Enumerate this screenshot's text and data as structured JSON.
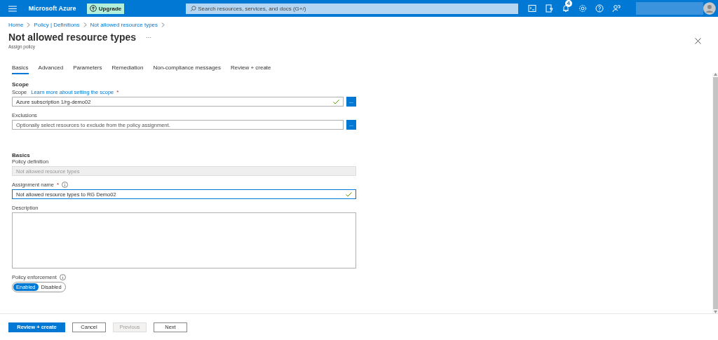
{
  "topbar": {
    "brand": "Microsoft Azure",
    "upgrade": "Upgrade",
    "search_placeholder": "Search resources, services, and docs (G+/)",
    "notification_count": "4"
  },
  "breadcrumb": [
    "Home",
    "Policy | Definitions",
    "Not allowed resource types"
  ],
  "title": "Not allowed resource types",
  "more": "···",
  "subtitle": "Assign policy",
  "tabs": [
    {
      "label": "Basics",
      "selected": true
    },
    {
      "label": "Advanced",
      "selected": false
    },
    {
      "label": "Parameters",
      "selected": false
    },
    {
      "label": "Remediation",
      "selected": false
    },
    {
      "label": "Non-compliance messages",
      "selected": false
    },
    {
      "label": "Review + create",
      "selected": false
    }
  ],
  "scope": {
    "heading": "Scope",
    "label": "Scope",
    "link": "Learn more about setting the scope",
    "required_mark": "*",
    "value": "Azure subscription 1/rg-demo02",
    "valid": true,
    "browse": "...",
    "exclusions_label": "Exclusions",
    "exclusions_placeholder": "Optionally select resources to exclude from the policy assignment.",
    "exclusions_browse": "..."
  },
  "basics": {
    "heading": "Basics",
    "definition_label": "Policy definition",
    "definition_value": "Not allowed resource types",
    "assignment_label": "Assignment name",
    "assignment_required": "*",
    "assignment_value": "Not allowed resource types to RG Demo02",
    "assignment_valid": true,
    "description_label": "Description",
    "enforcement_label": "Policy enforcement",
    "enforcement_options": [
      {
        "label": "Enabled",
        "selected": true
      },
      {
        "label": "Disabled",
        "selected": false
      }
    ]
  },
  "footer": [
    {
      "label": "Review + create",
      "kind": "primary",
      "disabled": false
    },
    {
      "label": "Cancel",
      "kind": "secondary",
      "disabled": false
    },
    {
      "label": "Previous",
      "kind": "secondary",
      "disabled": true
    },
    {
      "label": "Next",
      "kind": "secondary",
      "disabled": false
    }
  ]
}
